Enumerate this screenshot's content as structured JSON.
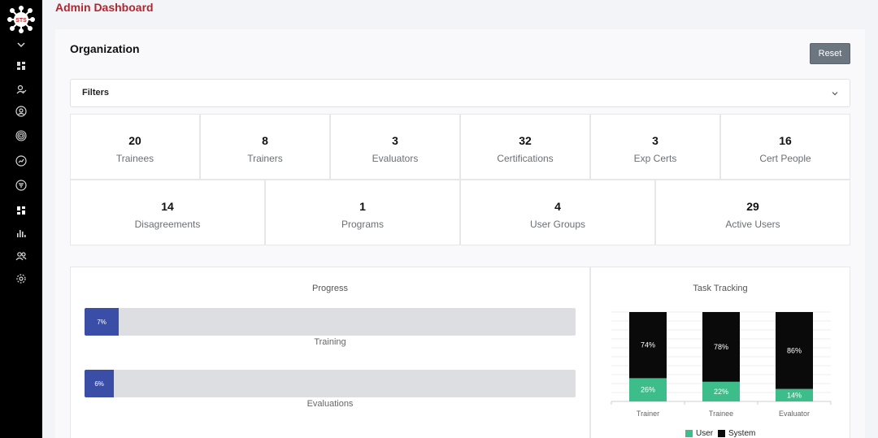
{
  "app": {
    "logo_text": "STS",
    "page_title": "Admin Dashboard"
  },
  "sidebar": {
    "icons": [
      "dashboard-icon",
      "user-check-icon",
      "user-circle-icon",
      "target-icon",
      "chart-circle-icon",
      "filter-circle-icon",
      "grid-icon",
      "bar-chart-icon",
      "users-icon",
      "gear-icon"
    ]
  },
  "organization": {
    "title": "Organization",
    "reset_label": "Reset",
    "filters_label": "Filters"
  },
  "stats_row1": [
    {
      "value": "20",
      "label": "Trainees"
    },
    {
      "value": "8",
      "label": "Trainers"
    },
    {
      "value": "3",
      "label": "Evaluators"
    },
    {
      "value": "32",
      "label": "Certifications"
    },
    {
      "value": "3",
      "label": "Exp Certs"
    },
    {
      "value": "16",
      "label": "Cert People"
    }
  ],
  "stats_row2": [
    {
      "value": "14",
      "label": "Disagreements"
    },
    {
      "value": "1",
      "label": "Programs"
    },
    {
      "value": "4",
      "label": "User Groups"
    },
    {
      "value": "29",
      "label": "Active Users"
    }
  ],
  "progress": {
    "title": "Progress",
    "bars": [
      {
        "label": "7%",
        "percent": 7,
        "caption": "Training"
      },
      {
        "label": "6%",
        "percent": 6,
        "caption": "Evaluations"
      }
    ]
  },
  "task_tracking": {
    "title": "Task Tracking",
    "colors": {
      "user": "#3dbd8a",
      "system": "#0a0a0a"
    },
    "legend": {
      "user": "User",
      "system": "System"
    }
  },
  "chart_data": {
    "type": "bar",
    "stacked": true,
    "title": "Task Tracking",
    "categories": [
      "Trainer",
      "Trainee",
      "Evaluator"
    ],
    "series": [
      {
        "name": "User",
        "values": [
          26,
          22,
          14
        ]
      },
      {
        "name": "System",
        "values": [
          74,
          78,
          86
        ]
      }
    ],
    "ylim": [
      0,
      100
    ],
    "grid": true,
    "legend_position": "bottom"
  }
}
